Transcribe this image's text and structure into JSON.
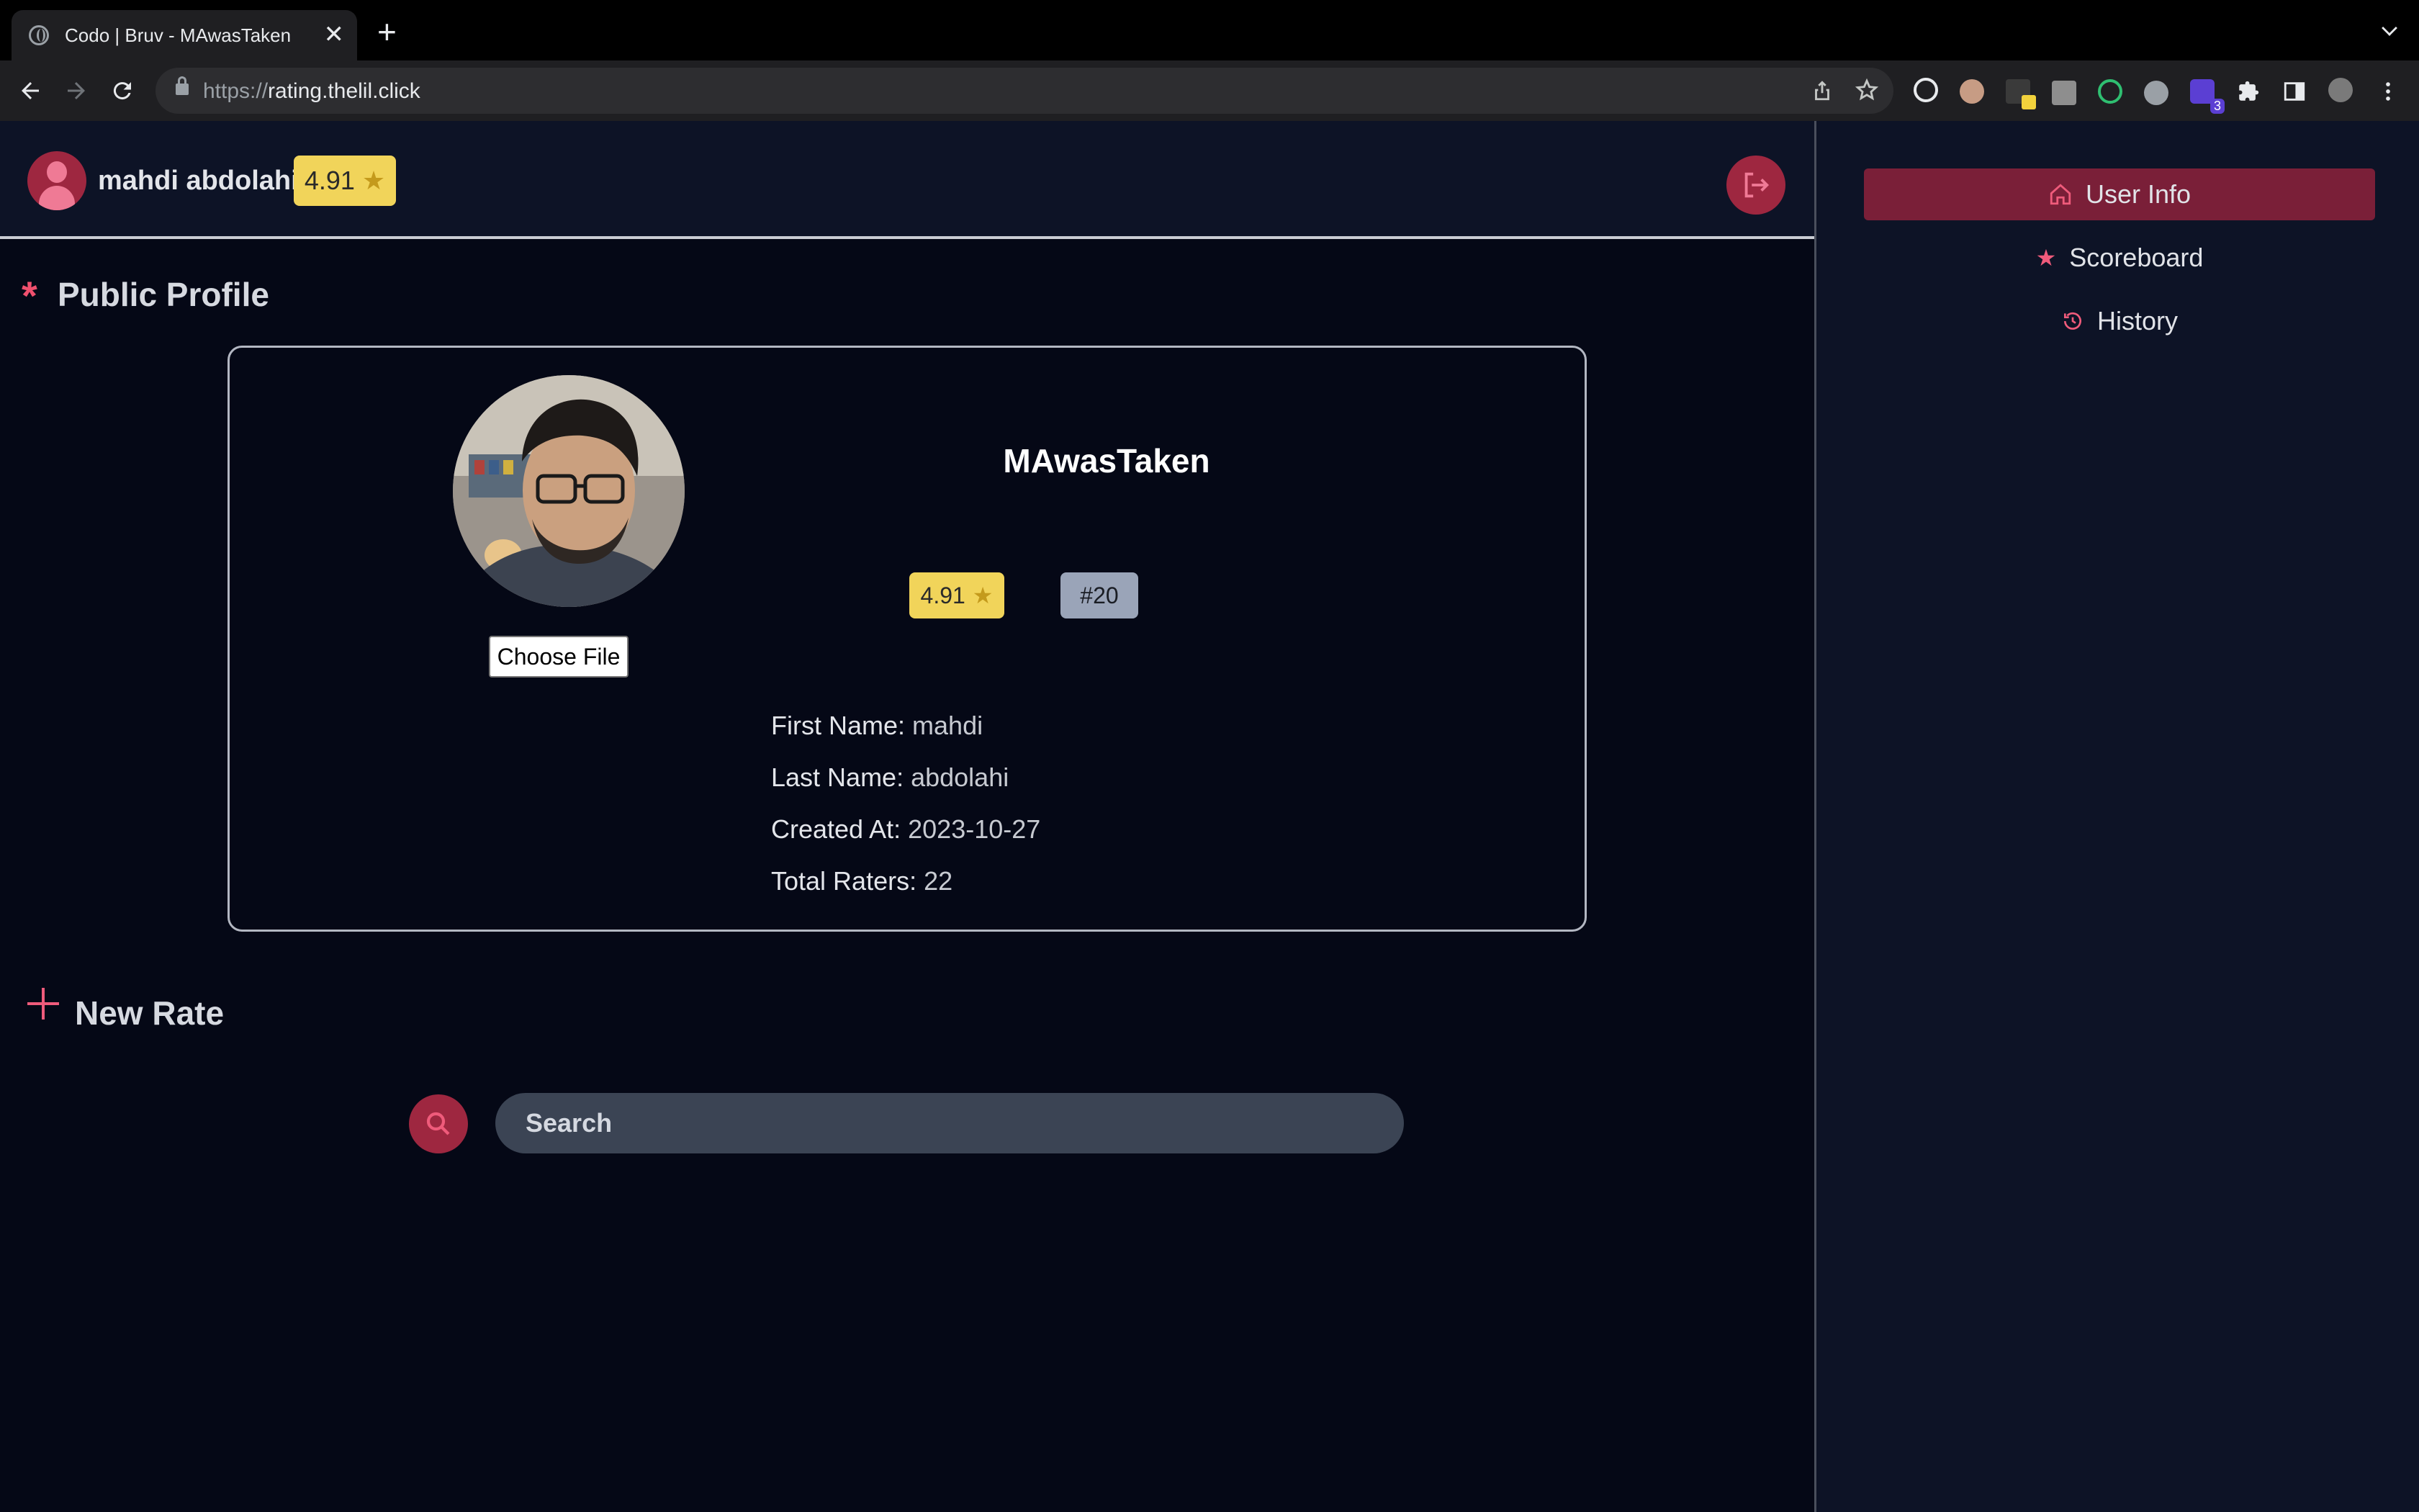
{
  "browser": {
    "tab_title": "Codo | Bruv - MAwasTaken",
    "tab_close": "✕",
    "new_tab": "+",
    "url_scheme": "https://",
    "url_host": "rating.thelil.click",
    "extension_badge": "3"
  },
  "header": {
    "user_name": "mahdi abdolahi",
    "rating": "4.91"
  },
  "sidebar": {
    "items": [
      {
        "label": "User Info",
        "icon": "home-icon",
        "active": true
      },
      {
        "label": "Scoreboard",
        "icon": "star-icon",
        "active": false
      },
      {
        "label": "History",
        "icon": "history-icon",
        "active": false
      }
    ]
  },
  "profile": {
    "section_title": "Public Profile",
    "username": "MAwasTaken",
    "rating": "4.91",
    "rank": "#20",
    "choose_file": "Choose File",
    "fields": [
      {
        "label": "First Name:",
        "value": "mahdi"
      },
      {
        "label": "Last Name:",
        "value": "abdolahi"
      },
      {
        "label": "Created At:",
        "value": "2023-10-27"
      },
      {
        "label": "Total Raters:",
        "value": "22"
      }
    ]
  },
  "new_rate": {
    "section_title": "New Rate",
    "search_placeholder": "Search"
  },
  "colors": {
    "background": "#050816",
    "panel": "#0d1326",
    "accent": "#9e2740",
    "accent_active": "#7a1f38",
    "rating_badge": "#f1d45a",
    "rank_badge": "#9aa4b8"
  }
}
